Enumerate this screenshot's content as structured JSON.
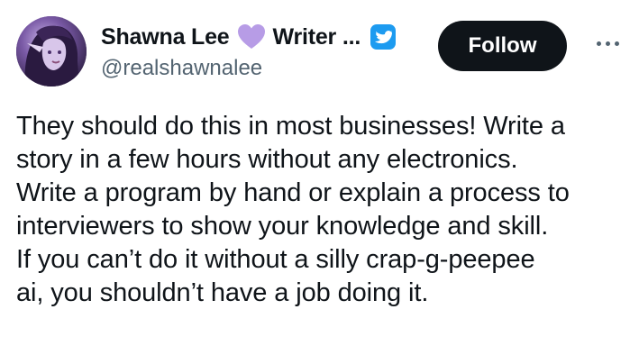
{
  "author": {
    "display_name": "Shawna Lee",
    "name_suffix": "Writer ...",
    "handle": "@realshawnalee",
    "heart_icon": "purple-heart-icon",
    "heart_color": "#b79ce6",
    "verified_icon": "verified-badge-icon",
    "verified_color": "#1d9bf0",
    "avatar_icon": "avatar"
  },
  "actions": {
    "follow_label": "Follow",
    "more_icon": "more-options-icon"
  },
  "tweet": {
    "lines": [
      "They should do this in most businesses! Write a",
      "story in a few hours without any electronics.",
      "Write a program by hand or explain a process to",
      "interviewers to show your knowledge and skill.",
      "If you can’t do it without a silly crap-g-peepee",
      "ai, you shouldn’t have a job doing it."
    ]
  },
  "colors": {
    "text_primary": "#0f1419",
    "text_secondary": "#536471",
    "follow_bg": "#0f1419",
    "follow_text": "#ffffff"
  }
}
